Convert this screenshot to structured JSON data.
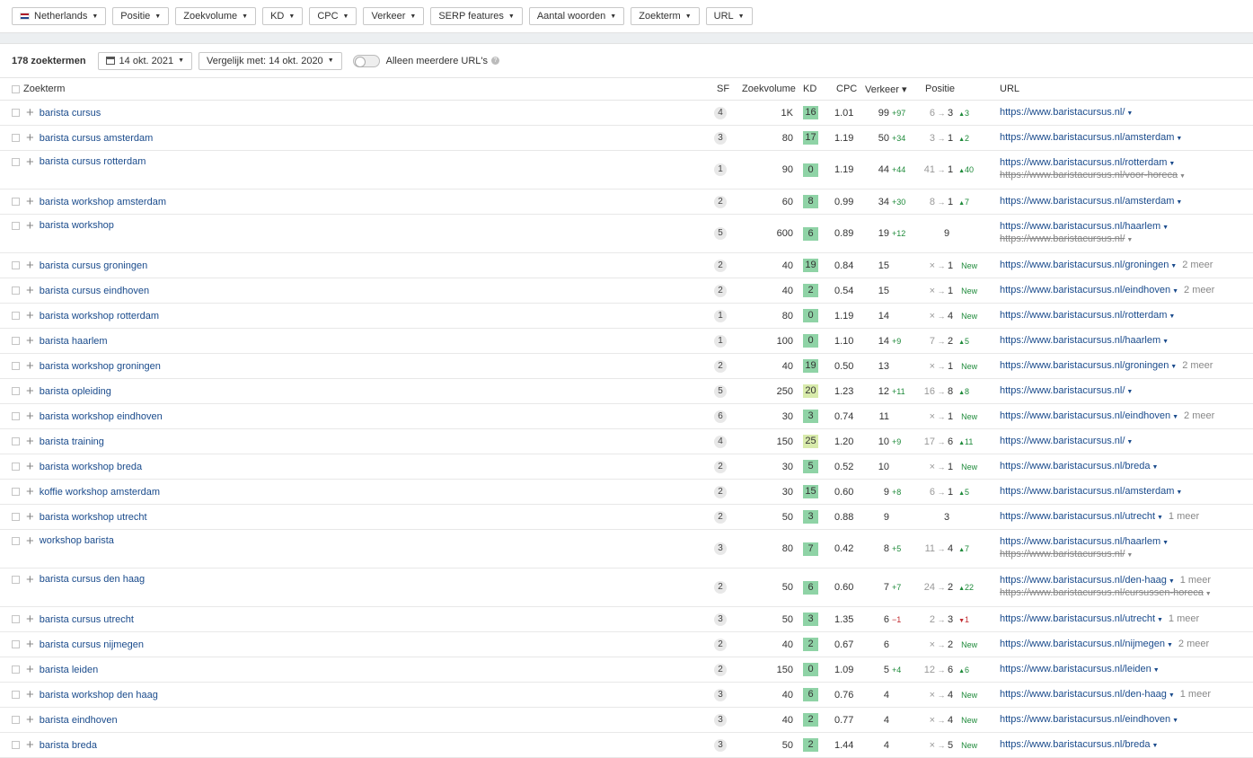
{
  "filters": [
    {
      "label": "Netherlands",
      "flag": true
    },
    {
      "label": "Positie"
    },
    {
      "label": "Zoekvolume"
    },
    {
      "label": "KD"
    },
    {
      "label": "CPC"
    },
    {
      "label": "Verkeer"
    },
    {
      "label": "SERP features"
    },
    {
      "label": "Aantal woorden"
    },
    {
      "label": "Zoekterm"
    },
    {
      "label": "URL"
    }
  ],
  "controls": {
    "count": "178 zoektermen",
    "date": "14 okt. 2021",
    "compare": "Vergelijk met: 14 okt. 2020",
    "toggle_label": "Alleen meerdere URL's",
    "help": "?"
  },
  "columns": {
    "keyword": "Zoekterm",
    "sf": "SF",
    "volume": "Zoekvolume",
    "kd": "KD",
    "cpc": "CPC",
    "traffic": "Verkeer ▾",
    "position": "Positie",
    "url": "URL"
  },
  "colors": {
    "link": "#1a4b8c",
    "kd_easy": "#8fd3a6",
    "kd_medium": "#d8ebab",
    "positive": "#1e8a3a",
    "negative": "#c0282d"
  },
  "rows": [
    {
      "kw": "barista cursus",
      "sf": "4",
      "vol": "1K",
      "kd": "16",
      "cpc": "1.01",
      "traffic": "99",
      "tchg": "+97",
      "pfrom": "6",
      "pto": "3",
      "pchg": "3",
      "pdir": "up",
      "url": "https://www.baristacursus.nl/"
    },
    {
      "kw": "barista cursus amsterdam",
      "sf": "3",
      "vol": "80",
      "kd": "17",
      "cpc": "1.19",
      "traffic": "50",
      "tchg": "+34",
      "pfrom": "3",
      "pto": "1",
      "pchg": "2",
      "pdir": "up",
      "url": "https://www.baristacursus.nl/amsterdam"
    },
    {
      "kw": "barista cursus rotterdam",
      "sf": "1",
      "vol": "90",
      "kd": "0",
      "cpc": "1.19",
      "traffic": "44",
      "tchg": "+44",
      "pfrom": "41",
      "pto": "1",
      "pchg": "40",
      "pdir": "up",
      "url": "https://www.baristacursus.nl/rotterdam",
      "url2": "https://www.baristacursus.nl/voor-horeca"
    },
    {
      "kw": "barista workshop amsterdam",
      "sf": "2",
      "vol": "60",
      "kd": "8",
      "cpc": "0.99",
      "traffic": "34",
      "tchg": "+30",
      "pfrom": "8",
      "pto": "1",
      "pchg": "7",
      "pdir": "up",
      "url": "https://www.baristacursus.nl/amsterdam"
    },
    {
      "kw": "barista workshop",
      "sf": "5",
      "vol": "600",
      "kd": "6",
      "cpc": "0.89",
      "traffic": "19",
      "tchg": "+12",
      "pfrom": "",
      "pto": "9",
      "pchg": "",
      "pdir": "",
      "url": "https://www.baristacursus.nl/haarlem",
      "url2": "https://www.baristacursus.nl/"
    },
    {
      "kw": "barista cursus groningen",
      "sf": "2",
      "vol": "40",
      "kd": "19",
      "cpc": "0.84",
      "traffic": "15",
      "tchg": "",
      "pfrom": "×",
      "pto": "1",
      "pchg": "New",
      "pdir": "new",
      "url": "https://www.baristacursus.nl/groningen",
      "more": "2 meer"
    },
    {
      "kw": "barista cursus eindhoven",
      "sf": "2",
      "vol": "40",
      "kd": "2",
      "cpc": "0.54",
      "traffic": "15",
      "tchg": "",
      "pfrom": "×",
      "pto": "1",
      "pchg": "New",
      "pdir": "new",
      "url": "https://www.baristacursus.nl/eindhoven",
      "more": "2 meer"
    },
    {
      "kw": "barista workshop rotterdam",
      "sf": "1",
      "vol": "80",
      "kd": "0",
      "cpc": "1.19",
      "traffic": "14",
      "tchg": "",
      "pfrom": "×",
      "pto": "4",
      "pchg": "New",
      "pdir": "new",
      "url": "https://www.baristacursus.nl/rotterdam"
    },
    {
      "kw": "barista haarlem",
      "sf": "1",
      "vol": "100",
      "kd": "0",
      "cpc": "1.10",
      "traffic": "14",
      "tchg": "+9",
      "pfrom": "7",
      "pto": "2",
      "pchg": "5",
      "pdir": "up",
      "url": "https://www.baristacursus.nl/haarlem"
    },
    {
      "kw": "barista workshop groningen",
      "sf": "2",
      "vol": "40",
      "kd": "19",
      "cpc": "0.50",
      "traffic": "13",
      "tchg": "",
      "pfrom": "×",
      "pto": "1",
      "pchg": "New",
      "pdir": "new",
      "url": "https://www.baristacursus.nl/groningen",
      "more": "2 meer"
    },
    {
      "kw": "barista opleiding",
      "sf": "5",
      "vol": "250",
      "kd": "20",
      "cpc": "1.23",
      "traffic": "12",
      "tchg": "+11",
      "pfrom": "16",
      "pto": "8",
      "pchg": "8",
      "pdir": "up",
      "url": "https://www.baristacursus.nl/"
    },
    {
      "kw": "barista workshop eindhoven",
      "sf": "6",
      "vol": "30",
      "kd": "3",
      "cpc": "0.74",
      "traffic": "11",
      "tchg": "",
      "pfrom": "×",
      "pto": "1",
      "pchg": "New",
      "pdir": "new",
      "url": "https://www.baristacursus.nl/eindhoven",
      "more": "2 meer"
    },
    {
      "kw": "barista training",
      "sf": "4",
      "vol": "150",
      "kd": "25",
      "cpc": "1.20",
      "traffic": "10",
      "tchg": "+9",
      "pfrom": "17",
      "pto": "6",
      "pchg": "11",
      "pdir": "up",
      "url": "https://www.baristacursus.nl/"
    },
    {
      "kw": "barista workshop breda",
      "sf": "2",
      "vol": "30",
      "kd": "5",
      "cpc": "0.52",
      "traffic": "10",
      "tchg": "",
      "pfrom": "×",
      "pto": "1",
      "pchg": "New",
      "pdir": "new",
      "url": "https://www.baristacursus.nl/breda"
    },
    {
      "kw": "koffie workshop amsterdam",
      "sf": "2",
      "vol": "30",
      "kd": "15",
      "cpc": "0.60",
      "traffic": "9",
      "tchg": "+8",
      "pfrom": "6",
      "pto": "1",
      "pchg": "5",
      "pdir": "up",
      "url": "https://www.baristacursus.nl/amsterdam"
    },
    {
      "kw": "barista workshop utrecht",
      "sf": "2",
      "vol": "50",
      "kd": "3",
      "cpc": "0.88",
      "traffic": "9",
      "tchg": "",
      "pfrom": "",
      "pto": "3",
      "pchg": "",
      "pdir": "",
      "url": "https://www.baristacursus.nl/utrecht",
      "more": "1 meer"
    },
    {
      "kw": "workshop barista",
      "sf": "3",
      "vol": "80",
      "kd": "7",
      "cpc": "0.42",
      "traffic": "8",
      "tchg": "+5",
      "pfrom": "11",
      "pto": "4",
      "pchg": "7",
      "pdir": "up",
      "url": "https://www.baristacursus.nl/haarlem",
      "url2": "https://www.baristacursus.nl/"
    },
    {
      "kw": "barista cursus den haag",
      "sf": "2",
      "vol": "50",
      "kd": "6",
      "cpc": "0.60",
      "traffic": "7",
      "tchg": "+7",
      "pfrom": "24",
      "pto": "2",
      "pchg": "22",
      "pdir": "up",
      "url": "https://www.baristacursus.nl/den-haag",
      "more": "1 meer",
      "url2": "https://www.baristacursus.nl/cursussen-horeca"
    },
    {
      "kw": "barista cursus utrecht",
      "sf": "3",
      "vol": "50",
      "kd": "3",
      "cpc": "1.35",
      "traffic": "6",
      "tchg": "−1",
      "tneg": true,
      "pfrom": "2",
      "pto": "3",
      "pchg": "1",
      "pdir": "down",
      "url": "https://www.baristacursus.nl/utrecht",
      "more": "1 meer"
    },
    {
      "kw": "barista cursus nijmegen",
      "sf": "2",
      "vol": "40",
      "kd": "2",
      "cpc": "0.67",
      "traffic": "6",
      "tchg": "",
      "pfrom": "×",
      "pto": "2",
      "pchg": "New",
      "pdir": "new",
      "url": "https://www.baristacursus.nl/nijmegen",
      "more": "2 meer"
    },
    {
      "kw": "barista leiden",
      "sf": "2",
      "vol": "150",
      "kd": "0",
      "cpc": "1.09",
      "traffic": "5",
      "tchg": "+4",
      "pfrom": "12",
      "pto": "6",
      "pchg": "6",
      "pdir": "up",
      "url": "https://www.baristacursus.nl/leiden"
    },
    {
      "kw": "barista workshop den haag",
      "sf": "3",
      "vol": "40",
      "kd": "6",
      "cpc": "0.76",
      "traffic": "4",
      "tchg": "",
      "pfrom": "×",
      "pto": "4",
      "pchg": "New",
      "pdir": "new",
      "url": "https://www.baristacursus.nl/den-haag",
      "more": "1 meer"
    },
    {
      "kw": "barista eindhoven",
      "sf": "3",
      "vol": "40",
      "kd": "2",
      "cpc": "0.77",
      "traffic": "4",
      "tchg": "",
      "pfrom": "×",
      "pto": "4",
      "pchg": "New",
      "pdir": "new",
      "url": "https://www.baristacursus.nl/eindhoven"
    },
    {
      "kw": "barista breda",
      "sf": "3",
      "vol": "50",
      "kd": "2",
      "cpc": "1.44",
      "traffic": "4",
      "tchg": "",
      "pfrom": "×",
      "pto": "5",
      "pchg": "New",
      "pdir": "new",
      "url": "https://www.baristacursus.nl/breda"
    }
  ]
}
